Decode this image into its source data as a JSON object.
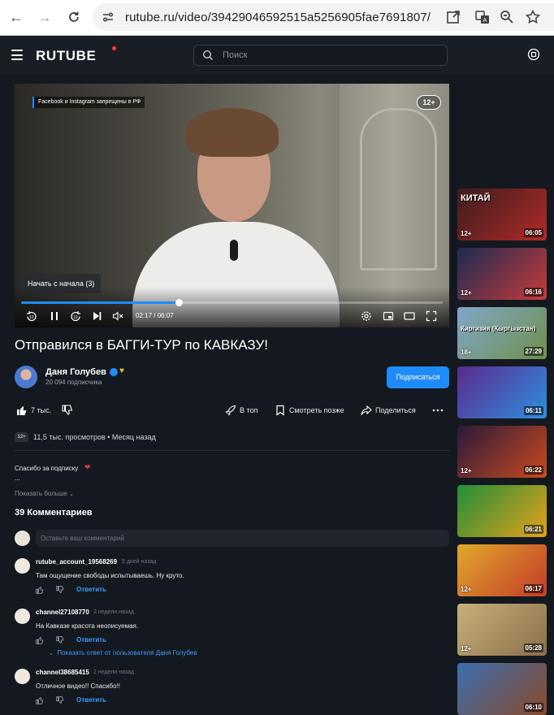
{
  "browser": {
    "url": "rutube.ru/video/39429046592515a5256905fae7691807/"
  },
  "header": {
    "logo": "RUTUBE",
    "search_placeholder": "Поиск"
  },
  "player": {
    "notice": "Facebook и Instagram запрещены в РФ",
    "age_rating": "12+",
    "resume_label": "Начать с начала (3)",
    "current_time": "02:17",
    "duration": "06:07",
    "progress_fraction": 0.374,
    "skip_seconds": "10"
  },
  "video": {
    "title": "Отправился в БАГГИ-ТУР по КАВКАЗУ!",
    "channel_name": "Даня Голубев",
    "subscribers": "20 094 подписчика",
    "subscribe_label": "Подписаться",
    "likes": "7 тыс.",
    "actions": {
      "top": "В топ",
      "watch_later": "Смотреть позже",
      "share": "Поделиться"
    },
    "age_badge": "12+",
    "views": "11,5 тыс. просмотров",
    "uploaded": "Месяц назад",
    "description": "Спасибо за подписку",
    "description_more": "...",
    "show_more": "Показать больше"
  },
  "comments": {
    "count_label": "39 Комментариев",
    "input_placeholder": "Оставьте ваш комментарий",
    "reply_label": "Ответить",
    "items": [
      {
        "user": "rutube_account_19568269",
        "when": "5 дней назад",
        "text": "Там ощущение свободы испытываешь. Ну круто."
      },
      {
        "user": "channel27108770",
        "when": "2 недели назад",
        "text": "На Кавказе красота неописуемая."
      },
      {
        "user": "channel38685415",
        "when": "2 недели назад",
        "text": "Отличное видео!! Спасибо!!"
      }
    ],
    "show_reply": "Показать ответ от пользователя Даня Голубев"
  },
  "sidebar": {
    "thumbs": [
      {
        "text": "КИТАЙ",
        "age": "12+",
        "duration": "06:05",
        "color_a": "#3b1d1d",
        "color_b": "#b12a2a"
      },
      {
        "text": "",
        "age": "12+",
        "duration": "06:16",
        "color_a": "#1c2b52",
        "color_b": "#c73b3b"
      },
      {
        "text": "Киргизия (Кыргызстан)",
        "age": "18+",
        "duration": "27:29",
        "color_a": "#7fa7c9",
        "color_b": "#6f8f4c"
      },
      {
        "text": "",
        "age": "",
        "duration": "06:11",
        "color_a": "#5b2a8c",
        "color_b": "#2f8fe0"
      },
      {
        "text": "",
        "age": "12+",
        "duration": "06:22",
        "color_a": "#2a1a3a",
        "color_b": "#c94a1f"
      },
      {
        "text": "",
        "age": "",
        "duration": "06:21",
        "color_a": "#1f8f3a",
        "color_b": "#e6a11a"
      },
      {
        "text": "",
        "age": "12+",
        "duration": "06:17",
        "color_a": "#e0a82a",
        "color_b": "#c43a2a"
      },
      {
        "text": "",
        "age": "12+",
        "duration": "05:28",
        "color_a": "#c7b07a",
        "color_b": "#8a6f4a"
      },
      {
        "text": "",
        "age": "",
        "duration": "06:10",
        "color_a": "#3a6fb0",
        "color_b": "#8a4a2a"
      }
    ]
  }
}
